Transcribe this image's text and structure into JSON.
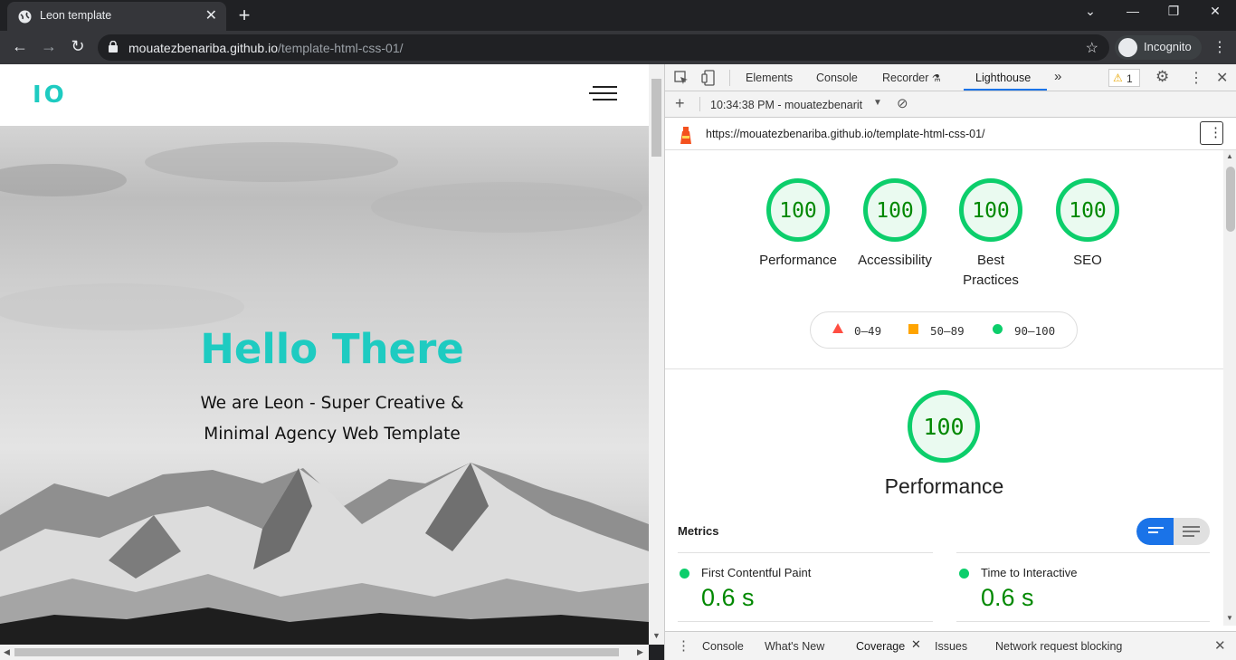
{
  "browser": {
    "tab_title": "Leon template",
    "url_host": "mouatezbenariba.github.io",
    "url_path": "/template-html-css-01/",
    "incognito_label": "Incognito"
  },
  "site": {
    "logo": "IO",
    "hero_title": "Hello There",
    "hero_line1": "We are Leon - Super Creative &",
    "hero_line2": "Minimal Agency Web Template"
  },
  "devtools": {
    "tabs": [
      "Elements",
      "Console",
      "Recorder",
      "Lighthouse"
    ],
    "active_tab": "Lighthouse",
    "warning_count": "1",
    "report_select": "10:34:38 PM - mouatezbenarit",
    "report_url": "https://mouatezbenariba.github.io/template-html-css-01/",
    "scores": [
      {
        "label": "Performance",
        "value": "100"
      },
      {
        "label": "Accessibility",
        "value": "100"
      },
      {
        "label": "Best Practices",
        "value": "100"
      },
      {
        "label": "SEO",
        "value": "100"
      }
    ],
    "legend": {
      "fail": "0–49",
      "average": "50–89",
      "pass": "90–100"
    },
    "performance": {
      "score": "100",
      "title": "Performance"
    },
    "metrics_label": "Metrics",
    "metrics": [
      {
        "name": "First Contentful Paint",
        "value": "0.6 s"
      },
      {
        "name": "Time to Interactive",
        "value": "0.6 s"
      }
    ],
    "drawer_tabs": [
      "Console",
      "What's New",
      "Coverage",
      "Issues",
      "Network request blocking"
    ],
    "colors": {
      "pass": "#0cce6b",
      "average": "#ffa400",
      "fail": "#ff4e42",
      "accent": "#1a73e8",
      "brand": "#1ecbc1"
    }
  }
}
